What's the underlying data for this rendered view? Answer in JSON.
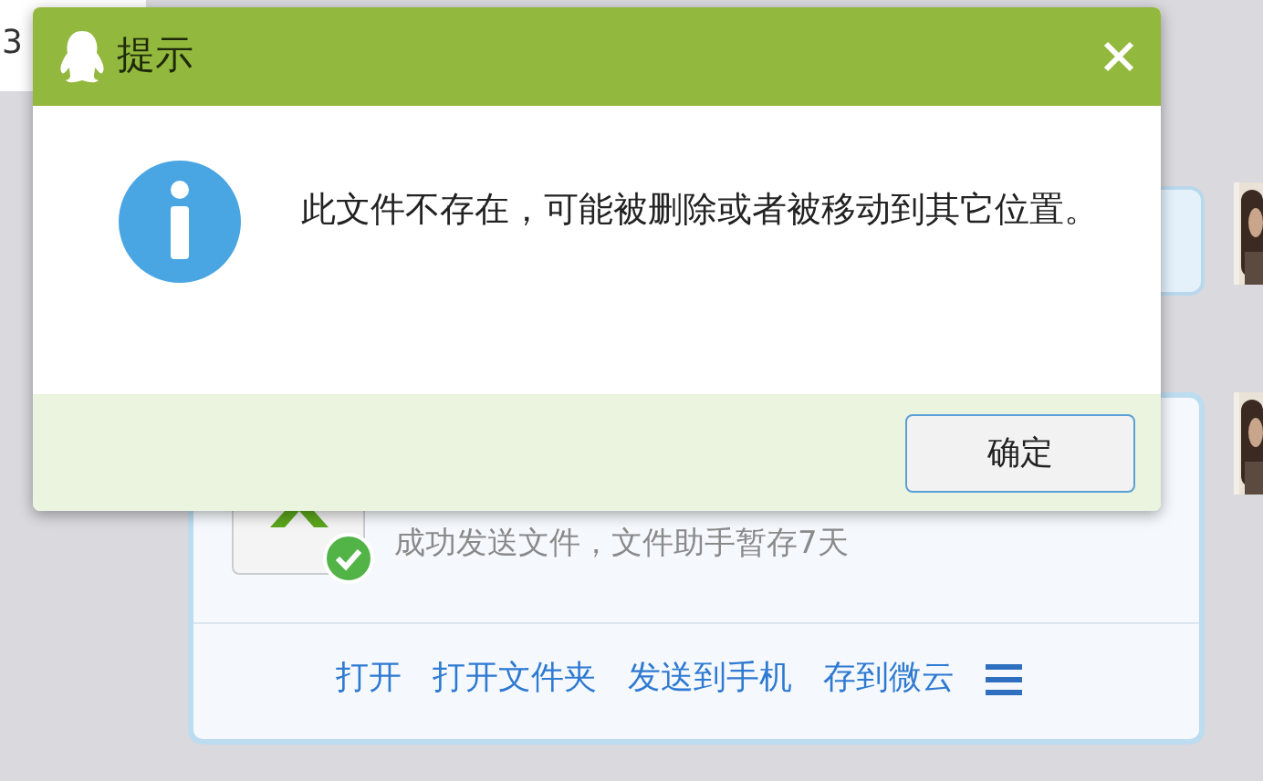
{
  "chat": {
    "input_text": "3",
    "file_message": {
      "status": "成功发送文件，文件助手暂存7天",
      "actions": [
        "打开",
        "打开文件夹",
        "发送到手机",
        "存到微云"
      ]
    }
  },
  "dialog": {
    "title": "提示",
    "message": "此文件不存在，可能被删除或者被移动到其它位置。",
    "buttons": [
      {
        "label": "确定"
      }
    ]
  }
}
